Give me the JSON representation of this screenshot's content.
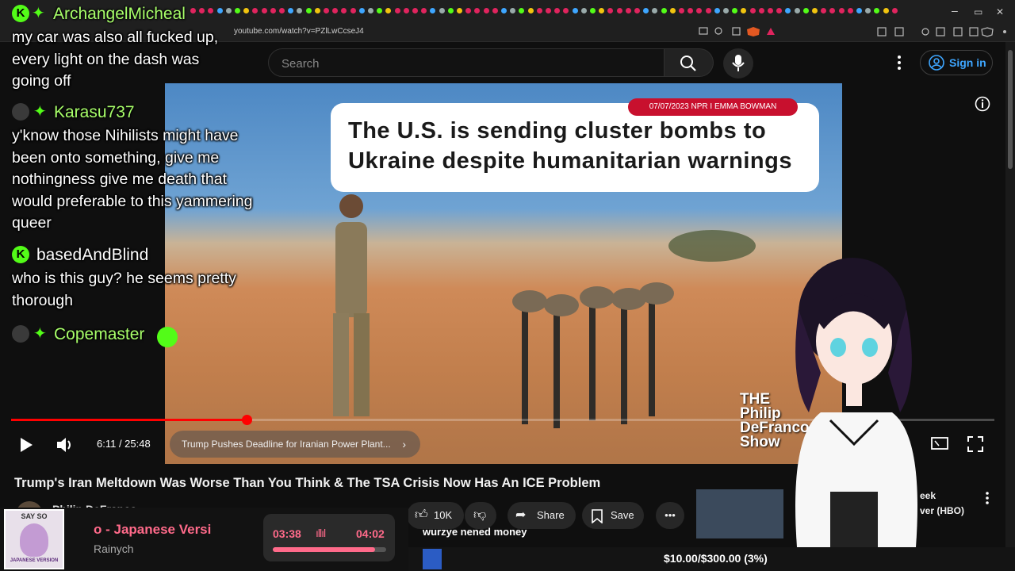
{
  "browser": {
    "url": "youtube.com/watch?v=PZlLwCcseJ4"
  },
  "header": {
    "search_placeholder": "Search",
    "signin_label": "Sign in",
    "icons": [
      "menu-icon",
      "search-icon",
      "mic-icon",
      "more-vert-icon",
      "account-icon"
    ]
  },
  "video": {
    "news_tag": "07/07/2023  NPR I EMMA BOWMAN",
    "news_headline": "The U.S. is sending cluster bombs to Ukraine despite humanitarian warnings",
    "time_current": "6:11",
    "time_total": "25:48",
    "time_label": "6:11 / 25:48",
    "progress_fraction": 0.2393,
    "chapter": "Trump Pushes Deadline for Iranian Power Plant...",
    "watermark": "THE Philip DeFranco Show"
  },
  "below": {
    "title": "Trump's Iran Meltdown Was Worse Than You Think & The TSA Crisis Now Has An ICE Problem",
    "channel": "Philip DeFranco",
    "like_count": "10K",
    "share_label": "Share",
    "save_label": "Save",
    "side_text_1": "eek",
    "side_text_2": "ver (HBO)"
  },
  "chat": [
    {
      "user": "ArchangelMicheal",
      "message": "my car was also all fucked up, every light on the dash was going off",
      "badge": "k"
    },
    {
      "user": "Karasu737",
      "message": "y'know those Nihilists might have been onto something, give me nothingness give me death that would preferable to this yammering queer",
      "badge": "avatar"
    },
    {
      "user": "basedAndBlind",
      "message": "who is this guy? he seems pretty thorough",
      "badge": "k"
    },
    {
      "user": "Copemaster",
      "message": "",
      "badge": "avatar"
    }
  ],
  "music": {
    "song": "o - Japanese Versi",
    "artist": "Rainych",
    "elapsed": "03:38",
    "duration": "04:02",
    "progress_fraction": 0.9,
    "cover_text_top": "SAY SO",
    "cover_text_bottom": "JAPANESE VERSION"
  },
  "bottom_bar": {
    "ticker": "wurzye nened money",
    "goal": "$10.00/$300.00 (3%)"
  },
  "colors": {
    "accent": "#ff0000",
    "chat_name": "#a8ff6a",
    "kick_green": "#53fc18",
    "signin_blue": "#3ea6ff",
    "news_red": "#c8102e"
  }
}
